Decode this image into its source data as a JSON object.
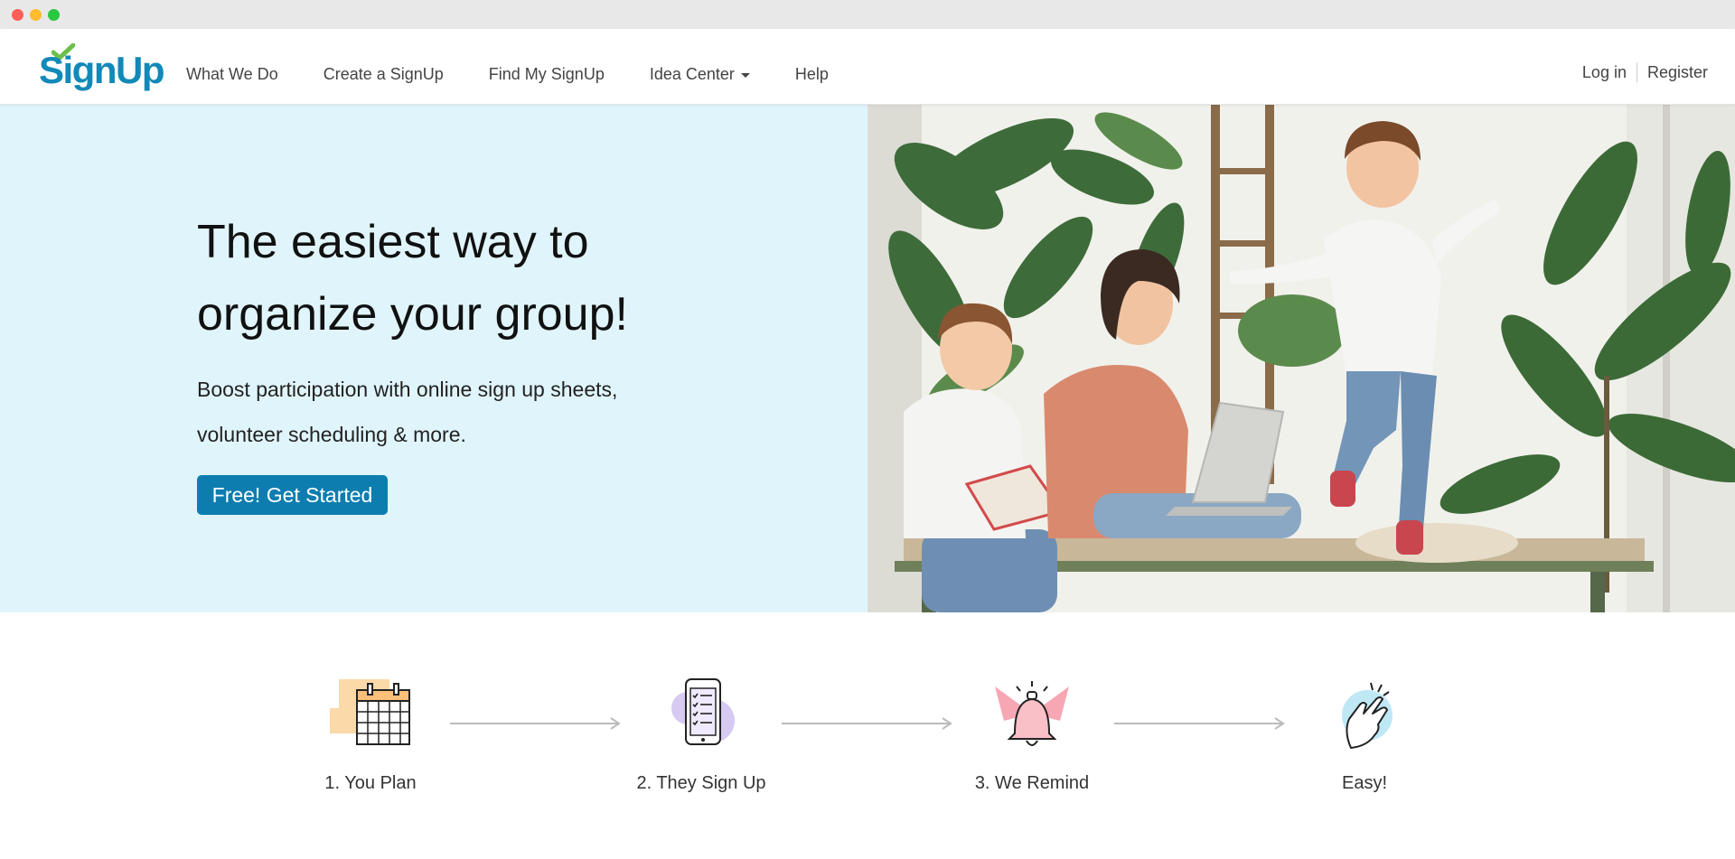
{
  "header": {
    "logo": "SignUp",
    "nav": [
      {
        "label": "What We Do"
      },
      {
        "label": "Create a SignUp"
      },
      {
        "label": "Find My SignUp"
      },
      {
        "label": "Idea Center",
        "dropdown": true
      },
      {
        "label": "Help"
      }
    ],
    "login": "Log in",
    "register": "Register"
  },
  "hero": {
    "title_line1": "The easiest way to",
    "title_line2": "organize your group!",
    "subtitle_line1": "Boost participation with online sign up sheets,",
    "subtitle_line2": "volunteer scheduling & more.",
    "cta": "Free! Get Started"
  },
  "steps": [
    {
      "label": "1. You Plan",
      "icon": "calendar-icon"
    },
    {
      "label": "2. They Sign Up",
      "icon": "phone-checklist-icon"
    },
    {
      "label": "3. We Remind",
      "icon": "bell-icon"
    },
    {
      "label": "Easy!",
      "icon": "finger-snap-icon"
    }
  ],
  "colors": {
    "brand": "#1289b8",
    "cta": "#0d7db0",
    "hero_bg": "#e0f5fb",
    "logo_check": "#6cc04a"
  }
}
